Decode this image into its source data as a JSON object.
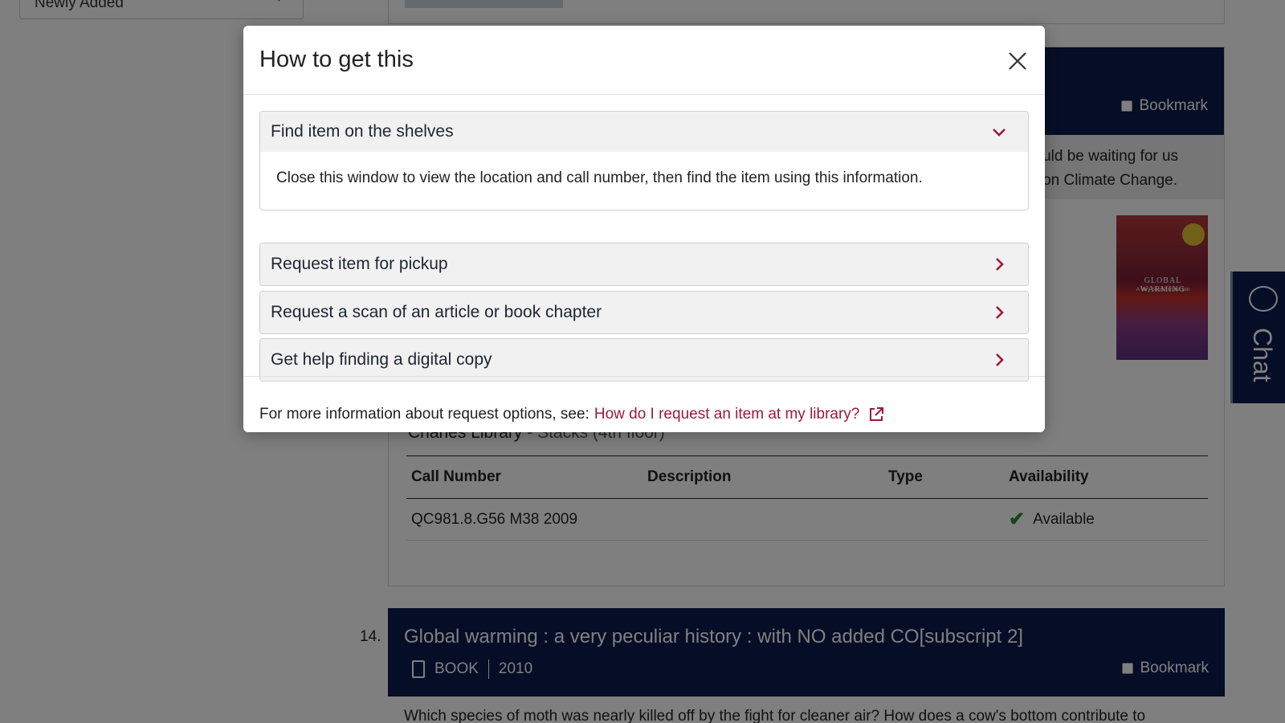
{
  "background": {
    "sort_select": {
      "value": "Newly Added"
    },
    "record13": {
      "bookmark_label": "Bookmark",
      "summary_lines": [
        "could be waiting for us",
        "el on Climate Change."
      ],
      "cover": {
        "title": "GLOBAL WARMING",
        "subtitle": "A Very Short Introduction"
      },
      "location": {
        "library": "Charles Library",
        "separator": " - ",
        "sublocation": "Stacks (4th floor)"
      },
      "holdings": {
        "headers": [
          "Call Number",
          "Description",
          "Type",
          "Availability"
        ],
        "rows": [
          {
            "call_number": "QC981.8.G56 M38 2009",
            "description": "",
            "type": "",
            "availability": "Available"
          }
        ]
      }
    },
    "record14": {
      "number": "14.",
      "title": "Global warming : a very peculiar history : with NO added CO[subscript 2]",
      "format": "BOOK",
      "year": "2010",
      "bookmark_label": "Bookmark",
      "description": "Which species of moth was nearly killed off by the fight for cleaner air? How does a cow's bottom contribute to"
    },
    "chat": {
      "label": "Chat"
    }
  },
  "modal": {
    "title": "How to get this",
    "sections": [
      {
        "label": "Find item on the shelves",
        "expanded": true,
        "body": "Close this window to view the location and call number, then find the item using this information."
      },
      {
        "label": "Request item for pickup",
        "expanded": false
      },
      {
        "label": "Request a scan of an article or book chapter",
        "expanded": false
      },
      {
        "label": "Get help finding a digital copy",
        "expanded": false
      }
    ],
    "footer": {
      "text": "For more information about request options, see:",
      "link": "How do I request an item at my library?"
    }
  },
  "colors": {
    "navy": "#0c1b4d",
    "accent": "#9a1b3b",
    "available_green": "#2a8a3a"
  }
}
